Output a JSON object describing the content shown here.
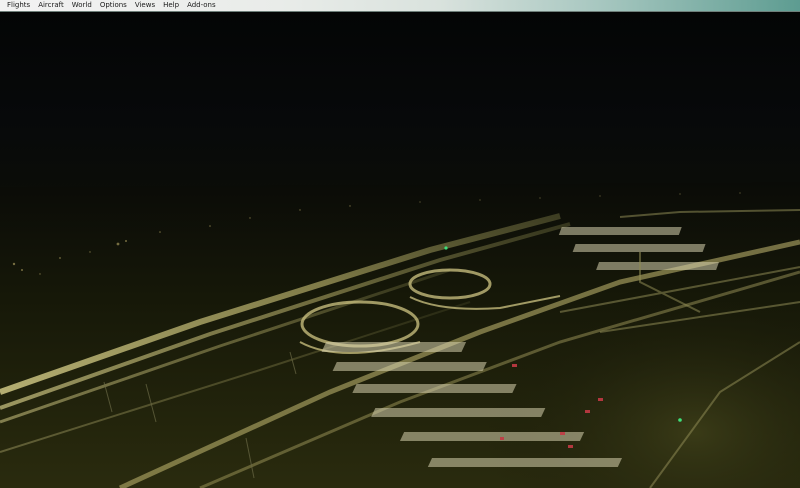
{
  "menubar": {
    "items": [
      "Flights",
      "Aircraft",
      "World",
      "Options",
      "Views",
      "Help",
      "Add-ons"
    ]
  },
  "scene": {
    "description_colors": {
      "sky": "#050605",
      "ground_dark": "#0d0f06",
      "highway_light": "#c9c27a",
      "parking_light": "#e8e2c4",
      "car_red": "#c0303a",
      "beacon_green": "#3fe07a"
    }
  }
}
